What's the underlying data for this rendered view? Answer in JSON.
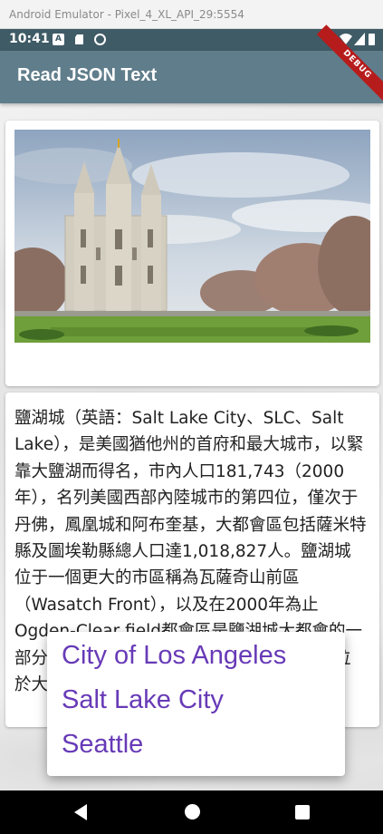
{
  "window": {
    "title": "Android Emulator - Pixel_4_XL_API_29:5554"
  },
  "status_bar": {
    "time": "10:41",
    "icons": [
      "a-notification-icon",
      "sd-card-icon",
      "dnd-icon",
      "wifi-icon",
      "signal-icon",
      "battery-icon"
    ]
  },
  "app_bar": {
    "title": "Read JSON Text",
    "background": "#607d8b",
    "debug_label": "DEBUG"
  },
  "content": {
    "image_alt": "Salt Lake Temple",
    "description": "鹽湖城（英語：Salt Lake City、SLC、Salt Lake），是美國猶他州的首府和最大城市，以緊靠大鹽湖而得名，市內人口181,743（2000年），名列美國西部內陸城市的第四位，僅次于丹佛，鳳凰城和阿布奎基，大都會區包括薩米特縣及圖埃勒縣總人口達1,018,827人。鹽湖城位于一個更大的市區稱為瓦薩奇山前區（Wasatch Front），以及在2000年為止Ogden-Clear field都會區是鹽湖城大都會的一部分，總人口數目達1,333,914人。鹽湖城位於大鹽湖東南端。"
  },
  "popup_menu": {
    "accent": "#673ab7",
    "items": [
      "City of Los Angeles",
      "Salt Lake City",
      "Seattle"
    ]
  },
  "nav_bar": {
    "buttons": [
      "back",
      "home",
      "recents"
    ]
  }
}
